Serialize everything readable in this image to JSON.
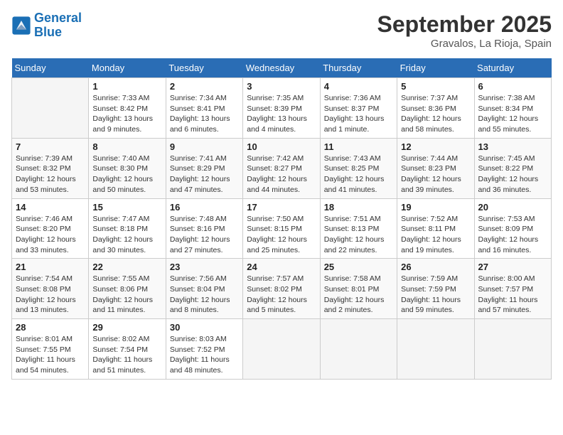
{
  "logo": {
    "line1": "General",
    "line2": "Blue"
  },
  "title": "September 2025",
  "location": "Gravalos, La Rioja, Spain",
  "days_of_week": [
    "Sunday",
    "Monday",
    "Tuesday",
    "Wednesday",
    "Thursday",
    "Friday",
    "Saturday"
  ],
  "weeks": [
    [
      {
        "day": "",
        "empty": true
      },
      {
        "day": "1",
        "sunrise": "7:33 AM",
        "sunset": "8:42 PM",
        "daylight": "13 hours and 9 minutes."
      },
      {
        "day": "2",
        "sunrise": "7:34 AM",
        "sunset": "8:41 PM",
        "daylight": "13 hours and 6 minutes."
      },
      {
        "day": "3",
        "sunrise": "7:35 AM",
        "sunset": "8:39 PM",
        "daylight": "13 hours and 4 minutes."
      },
      {
        "day": "4",
        "sunrise": "7:36 AM",
        "sunset": "8:37 PM",
        "daylight": "13 hours and 1 minute."
      },
      {
        "day": "5",
        "sunrise": "7:37 AM",
        "sunset": "8:36 PM",
        "daylight": "12 hours and 58 minutes."
      },
      {
        "day": "6",
        "sunrise": "7:38 AM",
        "sunset": "8:34 PM",
        "daylight": "12 hours and 55 minutes."
      }
    ],
    [
      {
        "day": "7",
        "sunrise": "7:39 AM",
        "sunset": "8:32 PM",
        "daylight": "12 hours and 53 minutes."
      },
      {
        "day": "8",
        "sunrise": "7:40 AM",
        "sunset": "8:30 PM",
        "daylight": "12 hours and 50 minutes."
      },
      {
        "day": "9",
        "sunrise": "7:41 AM",
        "sunset": "8:29 PM",
        "daylight": "12 hours and 47 minutes."
      },
      {
        "day": "10",
        "sunrise": "7:42 AM",
        "sunset": "8:27 PM",
        "daylight": "12 hours and 44 minutes."
      },
      {
        "day": "11",
        "sunrise": "7:43 AM",
        "sunset": "8:25 PM",
        "daylight": "12 hours and 41 minutes."
      },
      {
        "day": "12",
        "sunrise": "7:44 AM",
        "sunset": "8:23 PM",
        "daylight": "12 hours and 39 minutes."
      },
      {
        "day": "13",
        "sunrise": "7:45 AM",
        "sunset": "8:22 PM",
        "daylight": "12 hours and 36 minutes."
      }
    ],
    [
      {
        "day": "14",
        "sunrise": "7:46 AM",
        "sunset": "8:20 PM",
        "daylight": "12 hours and 33 minutes."
      },
      {
        "day": "15",
        "sunrise": "7:47 AM",
        "sunset": "8:18 PM",
        "daylight": "12 hours and 30 minutes."
      },
      {
        "day": "16",
        "sunrise": "7:48 AM",
        "sunset": "8:16 PM",
        "daylight": "12 hours and 27 minutes."
      },
      {
        "day": "17",
        "sunrise": "7:50 AM",
        "sunset": "8:15 PM",
        "daylight": "12 hours and 25 minutes."
      },
      {
        "day": "18",
        "sunrise": "7:51 AM",
        "sunset": "8:13 PM",
        "daylight": "12 hours and 22 minutes."
      },
      {
        "day": "19",
        "sunrise": "7:52 AM",
        "sunset": "8:11 PM",
        "daylight": "12 hours and 19 minutes."
      },
      {
        "day": "20",
        "sunrise": "7:53 AM",
        "sunset": "8:09 PM",
        "daylight": "12 hours and 16 minutes."
      }
    ],
    [
      {
        "day": "21",
        "sunrise": "7:54 AM",
        "sunset": "8:08 PM",
        "daylight": "12 hours and 13 minutes."
      },
      {
        "day": "22",
        "sunrise": "7:55 AM",
        "sunset": "8:06 PM",
        "daylight": "12 hours and 11 minutes."
      },
      {
        "day": "23",
        "sunrise": "7:56 AM",
        "sunset": "8:04 PM",
        "daylight": "12 hours and 8 minutes."
      },
      {
        "day": "24",
        "sunrise": "7:57 AM",
        "sunset": "8:02 PM",
        "daylight": "12 hours and 5 minutes."
      },
      {
        "day": "25",
        "sunrise": "7:58 AM",
        "sunset": "8:01 PM",
        "daylight": "12 hours and 2 minutes."
      },
      {
        "day": "26",
        "sunrise": "7:59 AM",
        "sunset": "7:59 PM",
        "daylight": "11 hours and 59 minutes."
      },
      {
        "day": "27",
        "sunrise": "8:00 AM",
        "sunset": "7:57 PM",
        "daylight": "11 hours and 57 minutes."
      }
    ],
    [
      {
        "day": "28",
        "sunrise": "8:01 AM",
        "sunset": "7:55 PM",
        "daylight": "11 hours and 54 minutes."
      },
      {
        "day": "29",
        "sunrise": "8:02 AM",
        "sunset": "7:54 PM",
        "daylight": "11 hours and 51 minutes."
      },
      {
        "day": "30",
        "sunrise": "8:03 AM",
        "sunset": "7:52 PM",
        "daylight": "11 hours and 48 minutes."
      },
      {
        "day": "",
        "empty": true
      },
      {
        "day": "",
        "empty": true
      },
      {
        "day": "",
        "empty": true
      },
      {
        "day": "",
        "empty": true
      }
    ]
  ],
  "labels": {
    "sunrise": "Sunrise:",
    "sunset": "Sunset:",
    "daylight": "Daylight:"
  }
}
